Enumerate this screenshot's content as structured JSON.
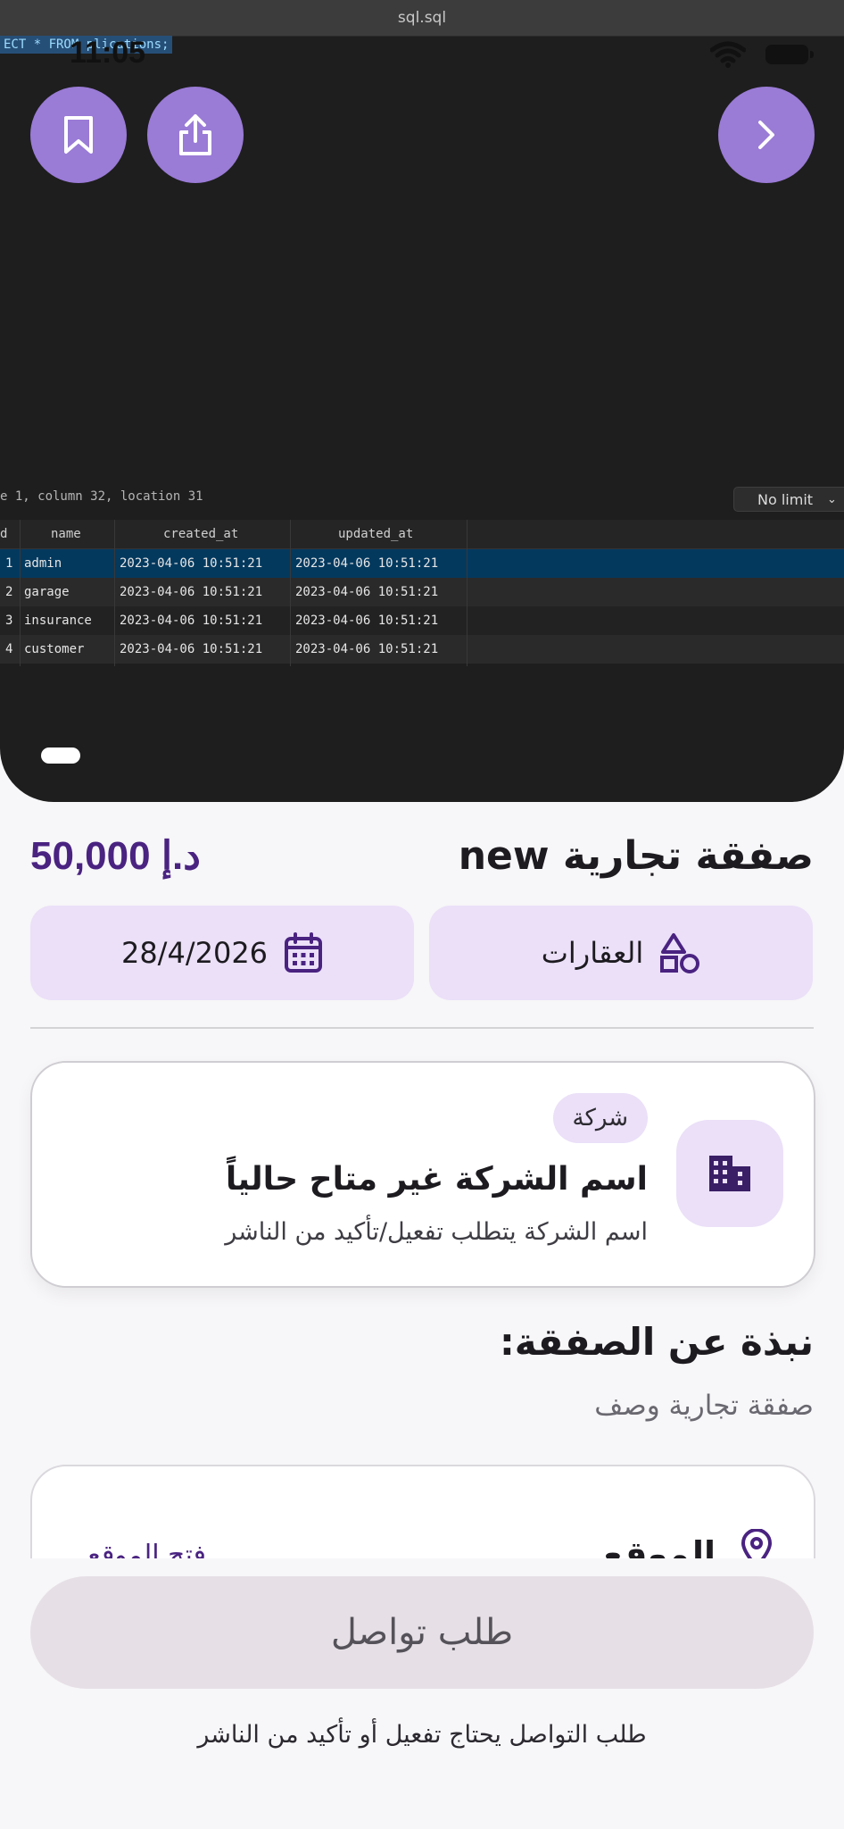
{
  "hero": {
    "window_title": "sql.sql",
    "query_text": "ECT * FROM    plications;",
    "cursor_position": "e 1, column 32, location 31",
    "limit_select": "No limit",
    "grid": {
      "columns": [
        "d",
        "name",
        "created_at",
        "updated_at"
      ],
      "rows": [
        {
          "id": "1",
          "name": "admin",
          "created_at": "2023-04-06 10:51:21",
          "updated_at": "2023-04-06 10:51:21"
        },
        {
          "id": "2",
          "name": "garage",
          "created_at": "2023-04-06 10:51:21",
          "updated_at": "2023-04-06 10:51:21"
        },
        {
          "id": "3",
          "name": "insurance",
          "created_at": "2023-04-06 10:51:21",
          "updated_at": "2023-04-06 10:51:21"
        },
        {
          "id": "4",
          "name": "customer",
          "created_at": "2023-04-06 10:51:21",
          "updated_at": "2023-04-06 10:51:21"
        }
      ]
    }
  },
  "status_bar": {
    "time": "11:05"
  },
  "icons": {
    "bookmark": "bookmark-icon",
    "share": "share-icon",
    "forward": "chevron-right-icon",
    "category": "shapes-icon",
    "date": "calendar-icon",
    "company": "building-icon",
    "location": "map-pin-icon"
  },
  "deal": {
    "price": "50,000 د.إ",
    "title": "صفقة تجارية new",
    "category": "العقارات",
    "date": "28/4/2026"
  },
  "company": {
    "badge": "شركة",
    "name": "اسم الشركة غير متاح حالياً",
    "note": "اسم الشركة يتطلب تفعيل/تأكيد من الناشر"
  },
  "about": {
    "title": "نبذة عن الصفقة:",
    "description": "صفقة تجارية وصف"
  },
  "location": {
    "label": "الموقع",
    "link": "فتح الموقع"
  },
  "contact": {
    "button_label": "طلب تواصل",
    "note": "طلب التواصل يحتاج تفعيل أو تأكيد من الناشر"
  },
  "colors": {
    "accent": "#4a2381",
    "chip_bg": "#ebe0f8",
    "fab_bg": "#9a7bd6"
  }
}
